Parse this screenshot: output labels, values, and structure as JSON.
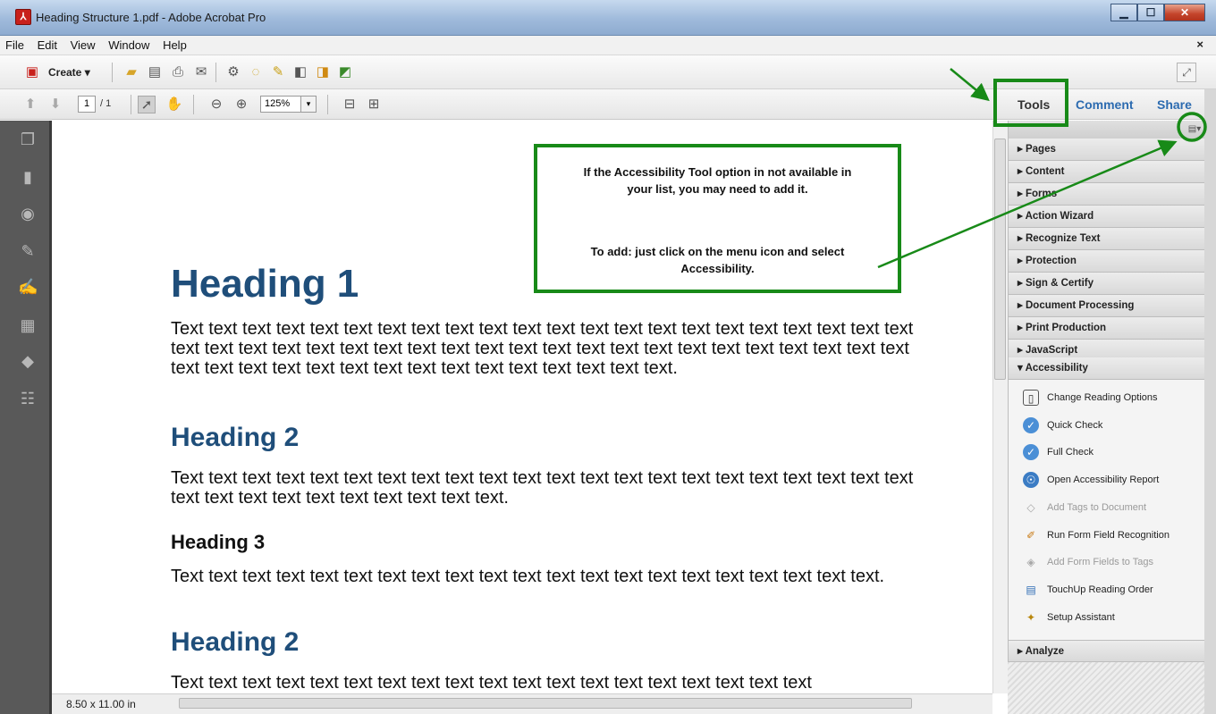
{
  "window": {
    "title": "Heading Structure 1.pdf - Adobe Acrobat Pro"
  },
  "menubar": {
    "items": [
      "File",
      "Edit",
      "View",
      "Window",
      "Help"
    ],
    "close": "×"
  },
  "toolbar": {
    "create_label": "Create ▾",
    "page_current": "1",
    "page_total": "/ 1",
    "zoom": "125%"
  },
  "pane_tabs": {
    "tools": "Tools",
    "comment": "Comment",
    "share": "Share"
  },
  "callout": {
    "line1": "If the Accessibility Tool option in not available in",
    "line2": "your list, you may need to add it.",
    "line3": "To add: just click on the menu icon and select",
    "line4": "Accessibility."
  },
  "document": {
    "heading1": "Heading 1",
    "para1": "Text text text text text text text text text text text text text text text text text text text text text text text text text text text text text text text text text text text text text text text text text text text text text text text text text text text text text text text text text text text.",
    "heading2a": "Heading 2",
    "para2": "Text text text text text text text text text text text text text text text text text text text text text text text text text text text text text text text text.",
    "heading3": "Heading 3",
    "para3": "Text text text text text text text text text text text text text text text text text text text text text.",
    "heading2b": "Heading 2",
    "para4": "Text text text text text text text text text text text text text text text text text text text"
  },
  "status": {
    "page_size": "8.50 x 11.00 in"
  },
  "tools_pane": {
    "sections": [
      "Pages",
      "Content",
      "Forms",
      "Action Wizard",
      "Recognize Text",
      "Protection",
      "Sign & Certify",
      "Document Processing",
      "Print Production",
      "JavaScript"
    ],
    "accessibility": "Accessibility",
    "analyze": "Analyze",
    "expanded_marker": "▾",
    "collapsed_marker": "▸",
    "items": [
      {
        "label": "Change Reading Options",
        "icon": "book-icon",
        "enabled": true
      },
      {
        "label": "Quick Check",
        "icon": "check-badge-icon",
        "enabled": true
      },
      {
        "label": "Full Check",
        "icon": "full-check-icon",
        "enabled": true
      },
      {
        "label": "Open Accessibility Report",
        "icon": "report-icon",
        "enabled": true
      },
      {
        "label": "Add Tags to Document",
        "icon": "tag-icon",
        "enabled": false
      },
      {
        "label": "Run Form Field Recognition",
        "icon": "form-field-icon",
        "enabled": true
      },
      {
        "label": "Add Form Fields to Tags",
        "icon": "tag-icon",
        "enabled": false
      },
      {
        "label": "TouchUp Reading Order",
        "icon": "reading-order-icon",
        "enabled": true
      },
      {
        "label": "Setup Assistant",
        "icon": "wand-icon",
        "enabled": true
      }
    ]
  },
  "colors": {
    "heading_blue": "#1f4e7a",
    "annotation_green": "#188a18"
  }
}
